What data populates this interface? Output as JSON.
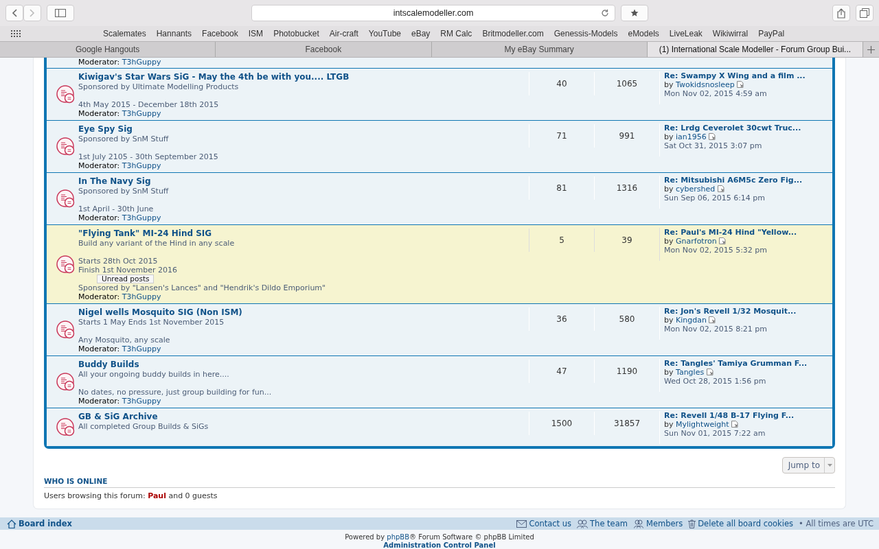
{
  "browser": {
    "url": "intscalemodeller.com",
    "bookmarks": [
      "Scalemates",
      "Hannants",
      "Facebook",
      "ISM",
      "Photobucket",
      "Air-craft",
      "YouTube",
      "eBay",
      "RM Calc",
      "Britmodeller.com",
      "Genessis-Models",
      "eModels",
      "LiveLeak",
      "Wikiwirral",
      "PayPal"
    ],
    "tabs": [
      {
        "label": "Google Hangouts",
        "selected": false
      },
      {
        "label": "Facebook",
        "selected": false
      },
      {
        "label": "My eBay Summary",
        "selected": false
      },
      {
        "label": "(1) International Scale Modeller - Forum Group Bui...",
        "selected": true
      }
    ]
  },
  "partial_row": {
    "moderator_label": "Moderator:",
    "moderator": "T3hGuppy"
  },
  "forums": [
    {
      "title": "Kiwigav's Star Wars SiG - May the 4th be with you.... LTGB",
      "description": [
        [
          "Sponsored by Ultimate Modelling Products"
        ],
        [
          "4th May 2015 - December 18th 2015"
        ]
      ],
      "moderator_label": "Moderator:",
      "moderator": "T3hGuppy",
      "topics": "40",
      "posts": "1065",
      "last_post": {
        "title": "Re: Swampy X Wing and a film ...",
        "by": "by",
        "author": "Twokidsnosleep",
        "date": "Mon Nov 02, 2015 4:59 am"
      },
      "highlighted": false
    },
    {
      "title": "Eye Spy Sig",
      "description": [
        [
          "Sponsored by SnM Stuff"
        ],
        [
          "1st July 2105 - 30th September 2015"
        ]
      ],
      "moderator_label": "Moderator:",
      "moderator": "T3hGuppy",
      "topics": "71",
      "posts": "991",
      "last_post": {
        "title": "Re: Lrdg Ceverolet 30cwt Truc...",
        "by": "by",
        "author": "ian1956",
        "date": "Sat Oct 31, 2015 3:07 pm"
      },
      "highlighted": false
    },
    {
      "title": "In The Navy Sig",
      "description": [
        [
          "Sponsored by SnM Stuff"
        ],
        [
          "1st April - 30th June"
        ]
      ],
      "moderator_label": "Moderator:",
      "moderator": "T3hGuppy",
      "topics": "81",
      "posts": "1316",
      "last_post": {
        "title": "Re: Mitsubishi A6M5c Zero Fig...",
        "by": "by",
        "author": "cybershed",
        "date": "Sun Sep 06, 2015 6:14 pm"
      },
      "highlighted": false
    },
    {
      "title": "\"Flying Tank\" MI-24 Hind SIG",
      "description": [
        [
          "Build any variant of the Hind in any scale"
        ],
        [
          "Starts 28th Oct 2015",
          "Finish 1st November 2016"
        ],
        [
          "Sponsored by \"Lansen's Lances\" and \"Hendrik's Dildo Emporium\""
        ]
      ],
      "moderator_label": "Moderator:",
      "moderator": "T3hGuppy",
      "topics": "5",
      "posts": "39",
      "last_post": {
        "title": "Re: Paul's MI-24 Hind \"Yellow...",
        "by": "by",
        "author": "Gnarfotron",
        "date": "Mon Nov 02, 2015 5:32 pm"
      },
      "highlighted": true,
      "tooltip": "Unread posts"
    },
    {
      "title": "Nigel wells Mosquito SIG (Non ISM)",
      "description": [
        [
          "Starts 1 May Ends 1st November 2015"
        ],
        [
          "Any Mosquito, any scale"
        ]
      ],
      "moderator_label": "Moderator:",
      "moderator": "T3hGuppy",
      "topics": "36",
      "posts": "580",
      "last_post": {
        "title": "Re: Jon's Revell 1/32 Mosquit...",
        "by": "by",
        "author": "Kingdan",
        "date": "Mon Nov 02, 2015 8:21 pm"
      },
      "highlighted": false
    },
    {
      "title": "Buddy Builds",
      "description": [
        [
          "All your ongoing buddy builds in here...."
        ],
        [
          "No dates, no pressure, just group building for fun..."
        ]
      ],
      "moderator_label": "Moderator:",
      "moderator": "T3hGuppy",
      "topics": "47",
      "posts": "1190",
      "last_post": {
        "title": "Re: Tangles' Tamiya Grumman F...",
        "by": "by",
        "author": "Tangles",
        "date": "Wed Oct 28, 2015 1:56 pm"
      },
      "highlighted": false
    },
    {
      "title": "GB & SiG Archive",
      "description": [
        [
          "All completed Group Builds & SiGs"
        ]
      ],
      "topics": "1500",
      "posts": "31857",
      "last_post": {
        "title": "Re: Revell 1/48 B-17 Flying F...",
        "by": "by",
        "author": "Mylightweight",
        "date": "Sun Nov 01, 2015 7:22 am"
      },
      "highlighted": false
    }
  ],
  "jump_to": "Jump to",
  "who_is_online": {
    "heading": "WHO IS ONLINE",
    "prefix": "Users browsing this forum:",
    "user": "Paul",
    "suffix": "and 0 guests"
  },
  "footer_nav": {
    "board_index": "Board index",
    "links": [
      {
        "kind": "mail",
        "label": "Contact us"
      },
      {
        "kind": "team",
        "label": "The team"
      },
      {
        "kind": "members",
        "label": "Members"
      },
      {
        "kind": "trash",
        "label": "Delete all board cookies"
      }
    ],
    "timezone": "• All times are UTC"
  },
  "copyright": {
    "prefix": "Powered by",
    "link": "phpBB",
    "suffix": "® Forum Software © phpBB Limited",
    "admin": "Administration Control Panel"
  }
}
